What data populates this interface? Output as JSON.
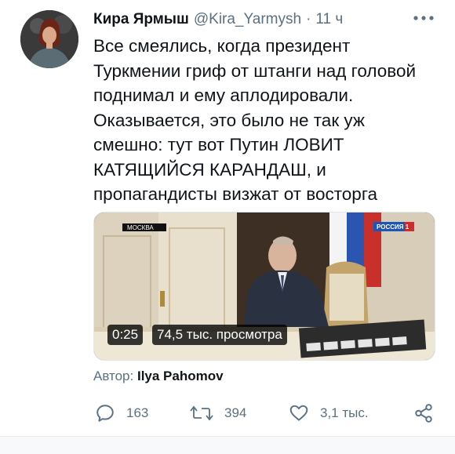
{
  "tweet": {
    "author_name": "Кира Ярмыш",
    "handle": "@Kira_Yarmysh",
    "separator": "·",
    "time": "11 ч",
    "text_lines": [
      "Все смеялись, когда президент",
      "Туркмении гриф от штанги над головой",
      "поднимал и ему аплодировали.",
      "Оказывается, это было не так уж",
      "смешно: тут вот Путин ЛОВИТ",
      "КАТЯЩИЙСЯ КАРАНДАШ, и",
      "пропагандисты визжат от восторга"
    ]
  },
  "media": {
    "tv_location_label": "МОСКВА",
    "channel_logo": "РОССИЯ 1",
    "duration": "0:25",
    "views": "74,5 тыс. просмотра"
  },
  "attribution": {
    "prefix": "Автор:",
    "name": "Ilya Pahomov"
  },
  "actions": {
    "reply_count": "163",
    "retweet_count": "394",
    "like_count": "3,1 тыс."
  },
  "icons": [
    "more-icon",
    "reply-icon",
    "retweet-icon",
    "like-icon",
    "share-icon"
  ],
  "colors": {
    "text_primary": "#0f1419",
    "text_secondary": "#5b7083",
    "background": "#ffffff"
  }
}
